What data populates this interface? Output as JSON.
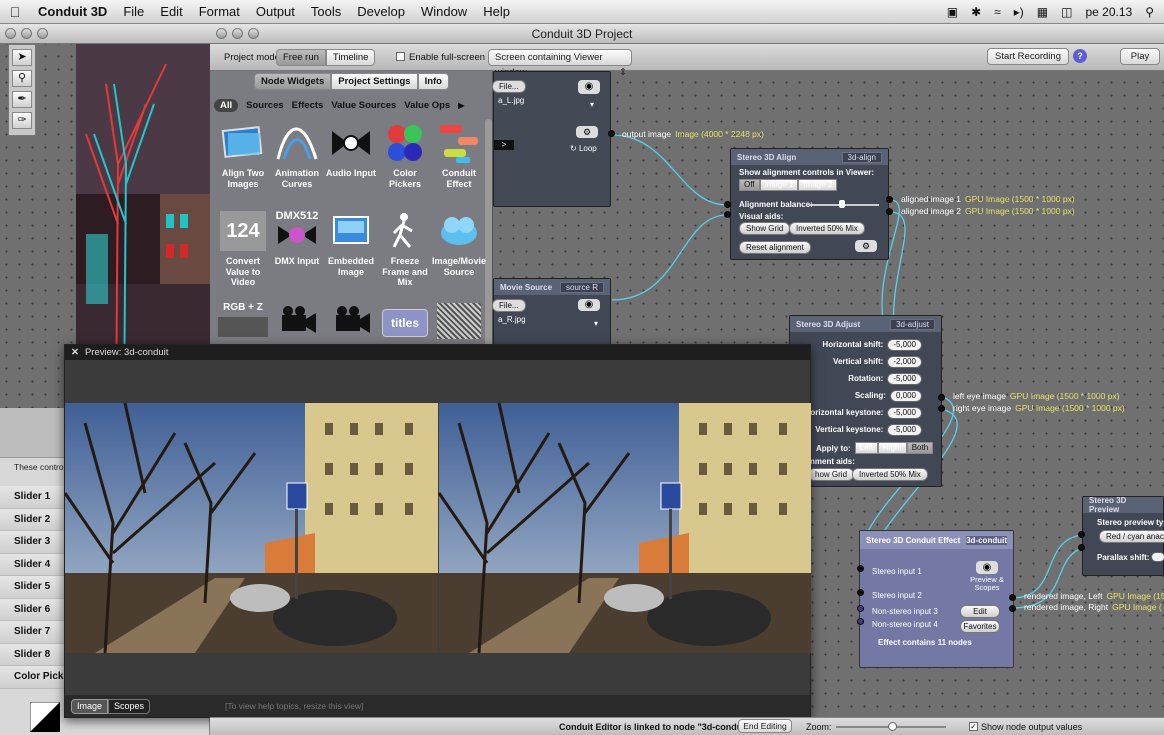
{
  "menubar": {
    "app_name": "Conduit 3D",
    "items": [
      "File",
      "Edit",
      "Format",
      "Output",
      "Tools",
      "Develop",
      "Window",
      "Help"
    ],
    "clock": "pe 20.13"
  },
  "window": {
    "title": "Conduit 3D Project"
  },
  "toolbar": {
    "project_mode_label": "Project mode:",
    "mode_free_run": "Free run",
    "mode_timeline": "Timeline",
    "fullscreen_label": "Enable full-screen on:",
    "fullscreen_value": "Screen containing Viewer window",
    "start_recording": "Start Recording",
    "help": "?",
    "play": "Play"
  },
  "library": {
    "tabs": [
      "Node Widgets",
      "Project Settings",
      "Info"
    ],
    "categories": [
      "All",
      "Sources",
      "Effects",
      "Value Sources",
      "Value Ops"
    ],
    "tiles": [
      {
        "label": "Align Two Images"
      },
      {
        "label": "Animation Curves"
      },
      {
        "label": "Audio Input"
      },
      {
        "label": "Color Pickers"
      },
      {
        "label": "Conduit Effect"
      },
      {
        "label": "Convert Value to Video"
      },
      {
        "label": "DMX Input"
      },
      {
        "label": "Embedded Image"
      },
      {
        "label": "Freeze Frame and Mix"
      },
      {
        "label": "Image/Movie Source"
      }
    ],
    "tile_texts": {
      "dmx": "DMX512",
      "rgbz": "RGB + Z",
      "titles": "titles",
      "num": "124"
    }
  },
  "left_panel": {
    "desc": "These controls ... widget in the",
    "sliders": [
      "Slider 1",
      "Slider 2",
      "Slider 3",
      "Slider 4",
      "Slider 5",
      "Slider 6",
      "Slider 7",
      "Slider 8"
    ],
    "color_picker": "Color Picker"
  },
  "nodes": {
    "source_l": {
      "file_btn": "File...",
      "file_name": "a_L.jpg",
      "loop": "Loop",
      "output": "output image",
      "output_info": "Image (4000 * 2248 px)"
    },
    "source_r": {
      "title": "Movie Source",
      "tag": "source R",
      "file_btn": "File...",
      "file_name": "a_R.jpg"
    },
    "align": {
      "title": "Stereo 3D Align",
      "tag": "3d-align",
      "show_controls": "Show alignment controls in Viewer:",
      "opts": [
        "Off",
        "Image 1",
        "Image 2"
      ],
      "balance": "Alignment balance:",
      "visual_aids": "Visual aids:",
      "show_grid": "Show Grid",
      "inverted": "Inverted 50% Mix",
      "reset": "Reset alignment",
      "out1": "aligned image 1",
      "out1_info": "GPU Image (1500 * 1000 px)",
      "out2": "aligned image 2",
      "out2_info": "GPU Image (1500 * 1000 px)"
    },
    "adjust": {
      "title": "Stereo 3D Adjust",
      "tag": "3d-adjust",
      "rows": [
        {
          "label": "Horizontal shift:",
          "value": "-5,000"
        },
        {
          "label": "Vertical shift:",
          "value": "-2,000"
        },
        {
          "label": "Rotation:",
          "value": "-5,000"
        },
        {
          "label": "Scaling:",
          "value": "0,000"
        },
        {
          "label": "orizontal keystone:",
          "value": "-5,000"
        },
        {
          "label": "Vertical keystone:",
          "value": "-5,000"
        }
      ],
      "apply_to": "Apply to:",
      "apply_opts": [
        "Left",
        "Right",
        "Both"
      ],
      "aids": "nment aids:",
      "show_grid": "how Grid",
      "inverted": "Inverted 50% Mix",
      "out1": "left eye image",
      "out1_info": "GPU Image (1500 * 1000 px)",
      "out2": "right eye image",
      "out2_info": "GPU Image (1500 * 1000 px)"
    },
    "effect": {
      "title": "Stereo 3D Conduit Effect",
      "tag": "3d-conduit",
      "inputs": [
        "Stereo input 1",
        "Stereo input 2",
        "Non-stereo input 3",
        "Non-stereo input 4"
      ],
      "preview": "Preview & Scopes",
      "edit": "Edit",
      "favorites": "Favorites",
      "contains": "Effect contains 11 nodes",
      "out1": "rendered image, Left",
      "out1_info": "GPU Image (15",
      "out2": "rendered image, Right",
      "out2_info": "GPU Image ("
    },
    "preview": {
      "title": "Stereo 3D Preview",
      "type_label": "Stereo preview type:",
      "type_value": "Red / cyan anac",
      "parallax": "Parallax shift:"
    }
  },
  "preview_window": {
    "title": "Preview: 3d-conduit",
    "tab_image": "Image",
    "tab_scopes": "Scopes",
    "hint": "[To view help topics, resize this view]"
  },
  "status": {
    "linked": "Conduit Editor is linked to node \"3d-conduit\"",
    "end_editing": "End Editing",
    "zoom": "Zoom:",
    "show_outputs": "Show node output values"
  }
}
